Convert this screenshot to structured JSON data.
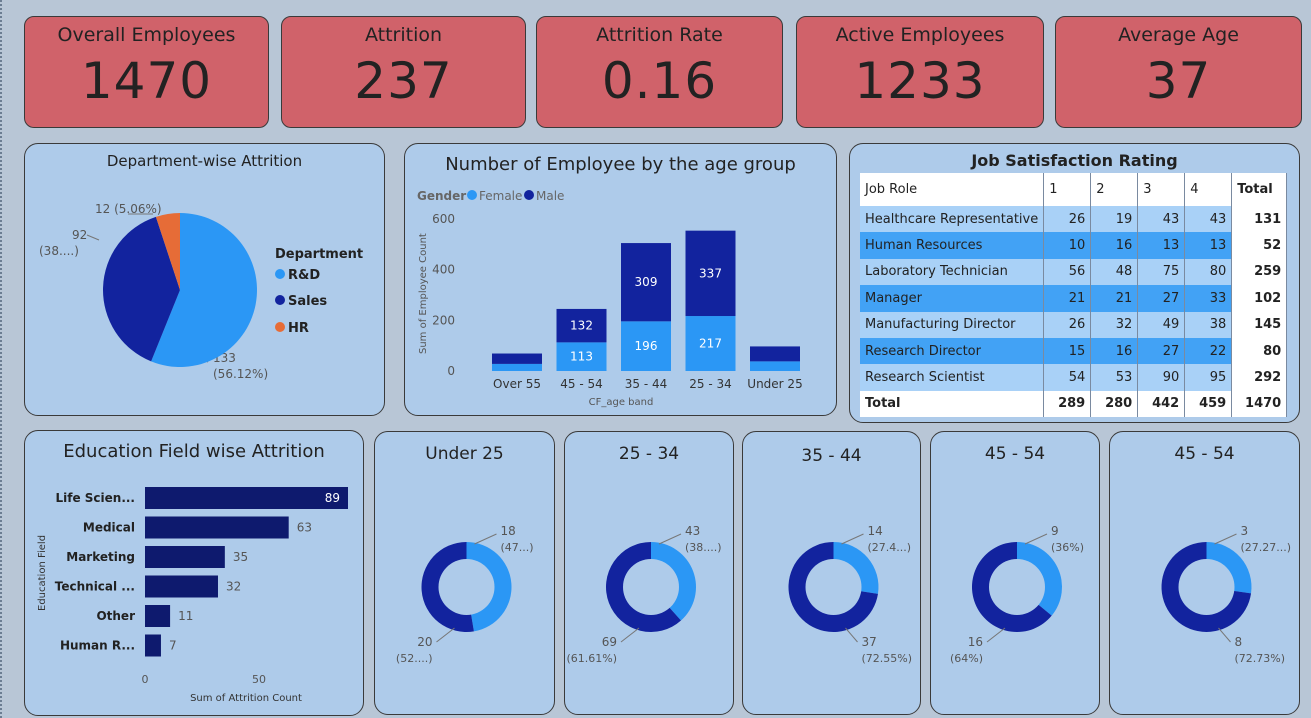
{
  "kpis": [
    {
      "title": "Overall Employees",
      "value": "1470"
    },
    {
      "title": "Attrition",
      "value": "237"
    },
    {
      "title": "Attrition Rate",
      "value": "0.16"
    },
    {
      "title": "Active Employees",
      "value": "1233"
    },
    {
      "title": "Average Age",
      "value": "37"
    }
  ],
  "colors": {
    "kpi_bg": "#d0626a",
    "card_bg": "#aecbea",
    "light_blue": "#2b97f5",
    "dark_blue": "#12239e",
    "orange": "#e66c37",
    "bar_navy": "#0e1a6e"
  },
  "chart_data": [
    {
      "type": "pie",
      "title": "Department-wise Attrition",
      "legend_title": "Department",
      "legend_position": "right",
      "slices": [
        {
          "label": "R&D",
          "value": 133,
          "pct_label": "(56.12%)",
          "value_label": "133",
          "color": "#2b97f5"
        },
        {
          "label": "Sales",
          "value": 92,
          "pct_label": "(38....)",
          "value_label": "92",
          "color": "#12239e"
        },
        {
          "label": "HR",
          "value": 12,
          "pct_label": "12 (5.06%)",
          "value_label": "",
          "color": "#e66c37"
        }
      ]
    },
    {
      "type": "bar",
      "stacked": true,
      "title": "Number of Employee by the age group",
      "legend_title": "Gender",
      "legend_position": "top-left",
      "xlabel": "CF_age band",
      "ylabel": "Sum of Employee Count",
      "ylim": [
        0,
        600
      ],
      "yticks": [
        "0",
        "200",
        "400",
        "600"
      ],
      "categories": [
        "Over 55",
        "45 - 54",
        "35 - 44",
        "25 - 34",
        "Under 25"
      ],
      "series": [
        {
          "name": "Female",
          "values": [
            28,
            113,
            196,
            217,
            38
          ],
          "labels": [
            "",
            "113",
            "196",
            "217",
            ""
          ],
          "color": "#2b97f5"
        },
        {
          "name": "Male",
          "values": [
            41,
            132,
            309,
            337,
            59
          ],
          "labels": [
            "",
            "132",
            "309",
            "337",
            ""
          ],
          "color": "#12239e"
        }
      ]
    },
    {
      "type": "table",
      "title": "Job Satisfaction Rating",
      "columns": [
        "Job Role",
        "1",
        "2",
        "3",
        "4",
        "Total"
      ],
      "rows": [
        [
          "Healthcare Representative",
          "26",
          "19",
          "43",
          "43",
          "131"
        ],
        [
          "Human Resources",
          "10",
          "16",
          "13",
          "13",
          "52"
        ],
        [
          "Laboratory Technician",
          "56",
          "48",
          "75",
          "80",
          "259"
        ],
        [
          "Manager",
          "21",
          "21",
          "27",
          "33",
          "102"
        ],
        [
          "Manufacturing Director",
          "26",
          "32",
          "49",
          "38",
          "145"
        ],
        [
          "Research Director",
          "15",
          "16",
          "27",
          "22",
          "80"
        ],
        [
          "Research Scientist",
          "54",
          "53",
          "90",
          "95",
          "292"
        ]
      ],
      "total": [
        "Total",
        "289",
        "280",
        "442",
        "459",
        "1470"
      ]
    },
    {
      "type": "bar",
      "orientation": "horizontal",
      "title": "Education Field wise Attrition",
      "xlabel": "Sum of Attrition Count",
      "ylabel": "Education Field",
      "xticks": [
        "0",
        "50"
      ],
      "xlim": [
        0,
        100
      ],
      "categories": [
        "Life Scien...",
        "Medical",
        "Marketing",
        "Technical ...",
        "Other",
        "Human R..."
      ],
      "values": [
        89,
        63,
        35,
        32,
        11,
        7
      ]
    },
    {
      "type": "pie",
      "donut": true,
      "title": "Under 25",
      "slices": [
        {
          "value": 18,
          "label": "18",
          "pct": "(47...)",
          "color": "#2b97f5"
        },
        {
          "value": 20,
          "label": "20",
          "pct": "(52....)",
          "color": "#12239e"
        }
      ]
    },
    {
      "type": "pie",
      "donut": true,
      "title": "25 - 34",
      "slices": [
        {
          "value": 43,
          "label": "43",
          "pct": "(38....)",
          "color": "#2b97f5"
        },
        {
          "value": 69,
          "label": "69",
          "pct": "(61.61%)",
          "color": "#12239e"
        }
      ]
    },
    {
      "type": "pie",
      "donut": true,
      "title": "35 - 44",
      "slices": [
        {
          "value": 14,
          "label": "14",
          "pct": "(27.4...)",
          "color": "#2b97f5"
        },
        {
          "value": 37,
          "label": "37",
          "pct": "(72.55%)",
          "color": "#12239e"
        }
      ]
    },
    {
      "type": "pie",
      "donut": true,
      "title": "45 - 54",
      "slices": [
        {
          "value": 9,
          "label": "9",
          "pct": "(36%)",
          "color": "#2b97f5"
        },
        {
          "value": 16,
          "label": "16",
          "pct": "(64%)",
          "color": "#12239e"
        }
      ]
    },
    {
      "type": "pie",
      "donut": true,
      "title": "45 - 54",
      "slices": [
        {
          "value": 3,
          "label": "3",
          "pct": "(27.27...)",
          "color": "#2b97f5"
        },
        {
          "value": 8,
          "label": "8",
          "pct": "(72.73%)",
          "color": "#12239e"
        }
      ]
    }
  ]
}
